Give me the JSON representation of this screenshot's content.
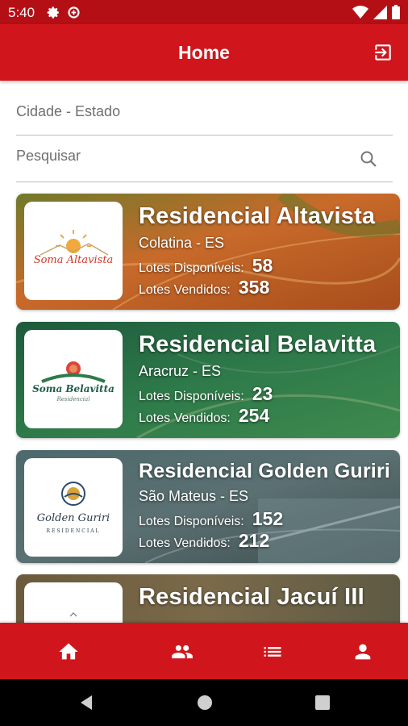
{
  "status_bar": {
    "time": "5:40"
  },
  "app_bar": {
    "title": "Home"
  },
  "filters": {
    "city_placeholder": "Cidade - Estado",
    "search_placeholder": "Pesquisar"
  },
  "projects": [
    {
      "name": "Residencial Altavista",
      "location": "Colatina - ES",
      "available_label": "Lotes Disponíveis:",
      "available": "58",
      "sold_label": "Lotes Vendidos:",
      "sold": "358",
      "logo_text": "Soma Altavista",
      "theme": "orange"
    },
    {
      "name": "Residencial Belavitta",
      "location": "Aracruz - ES",
      "available_label": "Lotes Disponíveis:",
      "available": "23",
      "sold_label": "Lotes Vendidos:",
      "sold": "254",
      "logo_text": "Soma Belavitta",
      "logo_sub": "Residencial",
      "theme": "green"
    },
    {
      "name": "Residencial Golden Guriri",
      "location": "São Mateus - ES",
      "available_label": "Lotes Disponíveis:",
      "available": "152",
      "sold_label": "Lotes Vendidos:",
      "sold": "212",
      "logo_text": "Golden Guriri",
      "logo_sub": "RESIDENCIAL",
      "theme": "slate"
    },
    {
      "name": "Residencial Jacuí III",
      "theme": "brown"
    }
  ],
  "bottom_nav": [
    "home-icon",
    "people-icon",
    "list-icon",
    "person-icon"
  ],
  "colors": {
    "primary": "#d0161c",
    "status_bar": "#b50f16"
  }
}
